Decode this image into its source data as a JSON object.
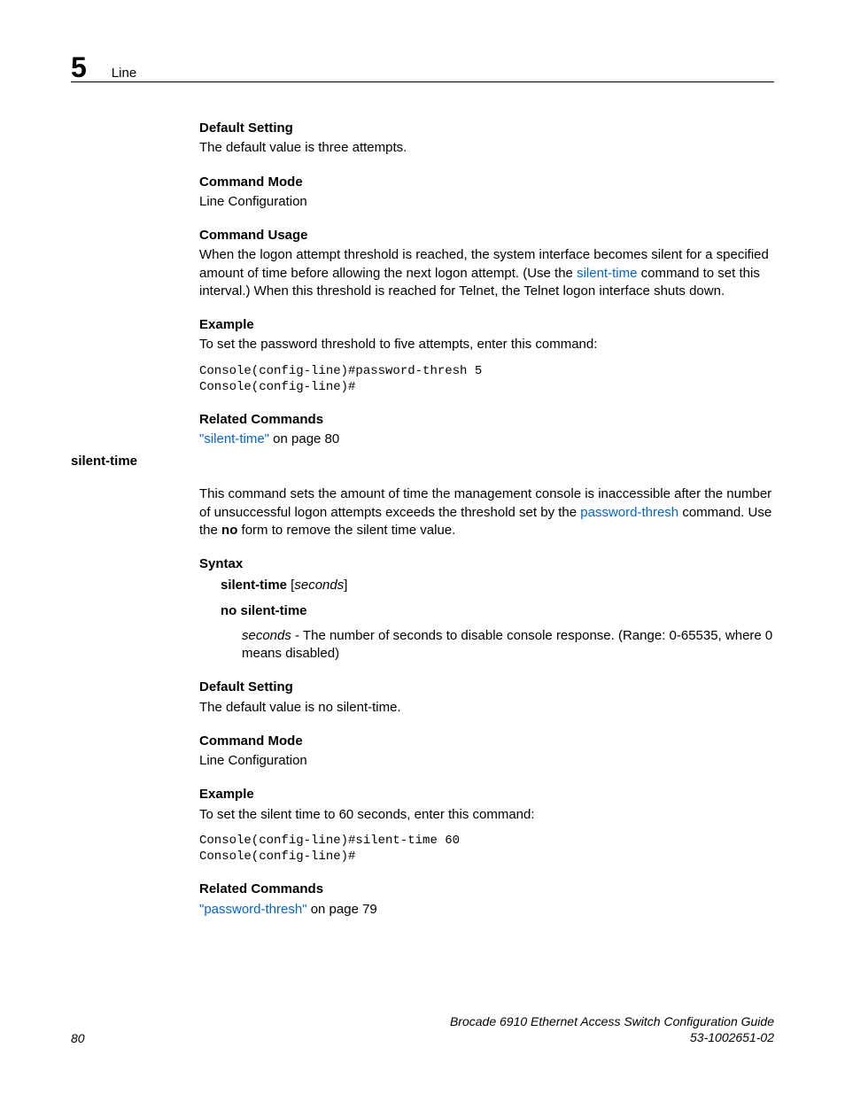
{
  "header": {
    "chapter_number": "5",
    "chapter_title": "Line"
  },
  "sections": {
    "default_setting_1": {
      "head": "Default Setting",
      "body": "The default value is three attempts."
    },
    "command_mode_1": {
      "head": "Command Mode",
      "body": "Line Configuration"
    },
    "command_usage": {
      "head": "Command Usage",
      "pre": "When the logon attempt threshold is reached, the system interface becomes silent for a specified amount of time before allowing the next logon attempt. (Use the ",
      "link": "silent-time",
      "post": " command to set this interval.) When this threshold is reached for Telnet, the Telnet logon interface shuts down."
    },
    "example_1": {
      "head": "Example",
      "intro": "To set the password threshold to five attempts, enter this command:",
      "code": "Console(config-line)#password-thresh 5\nConsole(config-line)#"
    },
    "related_1": {
      "head": "Related Commands",
      "link": "\"silent-time\"",
      "suffix": " on page 80"
    },
    "silent_time_side": "silent-time",
    "silent_time_intro": {
      "pre": "This command sets the amount of time the management console is inaccessible after the number of unsuccessful logon attempts exceeds the threshold set by the ",
      "link": "password-thresh",
      "mid": " command. Use the ",
      "bold": "no",
      "post": " form to remove the silent time value."
    },
    "syntax": {
      "head": "Syntax",
      "line1_bold": "silent-time",
      "line1_open": " [",
      "line1_italic": "seconds",
      "line1_close": "]",
      "line2": "no silent-time",
      "param_name": "seconds",
      "param_desc": " - The number of seconds to disable console response. (Range: 0-65535, where 0 means disabled)"
    },
    "default_setting_2": {
      "head": "Default Setting",
      "body": "The default value is no silent-time."
    },
    "command_mode_2": {
      "head": "Command Mode",
      "body": "Line Configuration"
    },
    "example_2": {
      "head": "Example",
      "intro": "To set the silent time to 60 seconds, enter this command:",
      "code": "Console(config-line)#silent-time 60\nConsole(config-line)#"
    },
    "related_2": {
      "head": "Related Commands",
      "link": "\"password-thresh\"",
      "suffix": " on page 79"
    }
  },
  "footer": {
    "page_number": "80",
    "guide_title": "Brocade 6910 Ethernet Access Switch Configuration Guide",
    "doc_number": "53-1002651-02"
  }
}
